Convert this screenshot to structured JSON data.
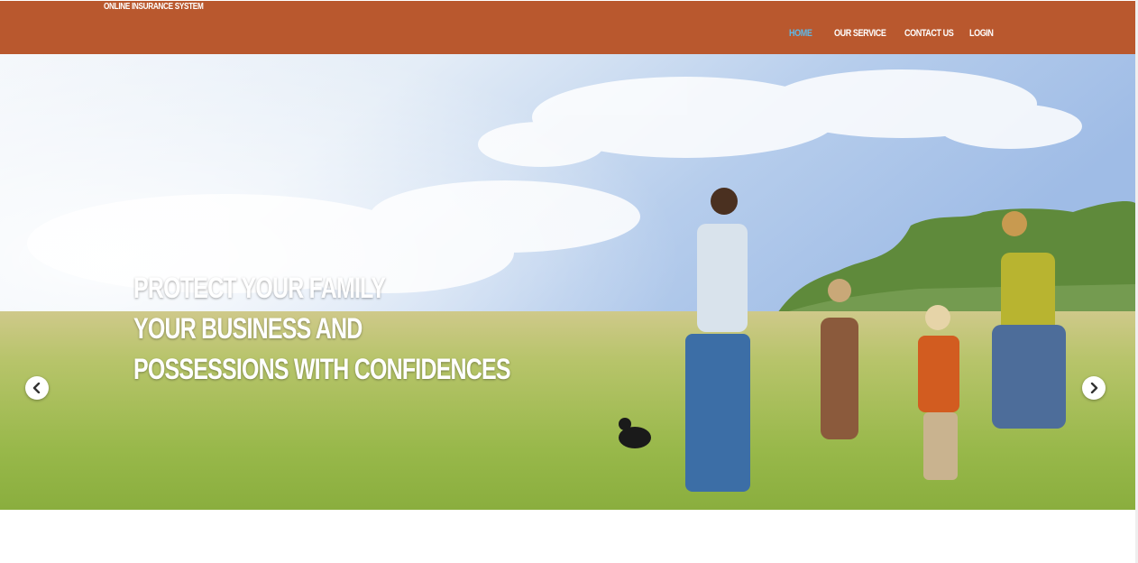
{
  "header": {
    "brand": "ONLINE INSURANCE SYSTEM",
    "nav": [
      {
        "label": "HOME",
        "active": true
      },
      {
        "label": "OUR SERVICE",
        "active": false
      },
      {
        "label": "CONTACT US",
        "active": false
      },
      {
        "label": "LOGIN",
        "active": false
      }
    ]
  },
  "carousel": {
    "caption_lines": [
      "PROTECT YOUR FAMILY",
      "YOUR BUSINESS AND",
      "POSSESSIONS WITH CONFIDENCES"
    ],
    "image": "family-walking-in-field",
    "prev_icon": "chevron-left-icon",
    "next_icon": "chevron-right-icon"
  },
  "colors": {
    "header_bg": "#b9582e",
    "nav_active": "#5fb8e6",
    "nav_text": "#ffffff"
  }
}
